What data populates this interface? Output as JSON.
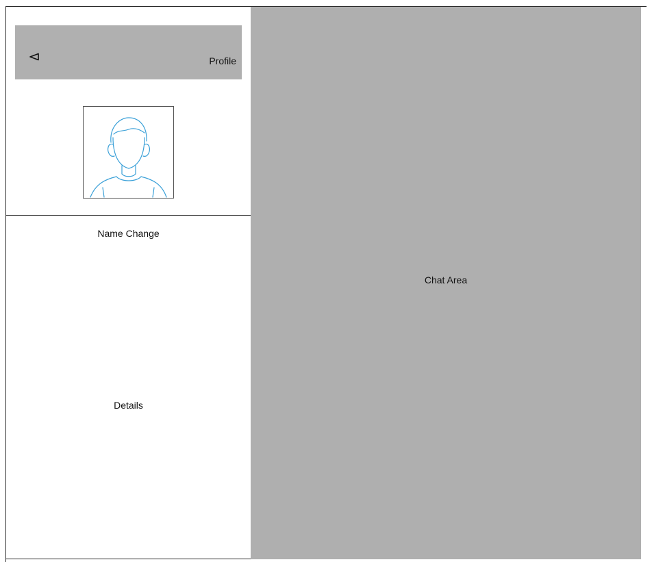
{
  "header": {
    "title": "Profile",
    "back_icon": "back-triangle-icon"
  },
  "avatar": {
    "icon": "user-avatar-icon",
    "stroke_color": "#3aa0d8"
  },
  "sidebar": {
    "name_change_label": "Name Change",
    "details_label": "Details"
  },
  "chat": {
    "label": "Chat Area"
  },
  "colors": {
    "header_bg": "#b0b0b0",
    "chat_bg": "#afafaf",
    "border": "#2a2a2a"
  }
}
